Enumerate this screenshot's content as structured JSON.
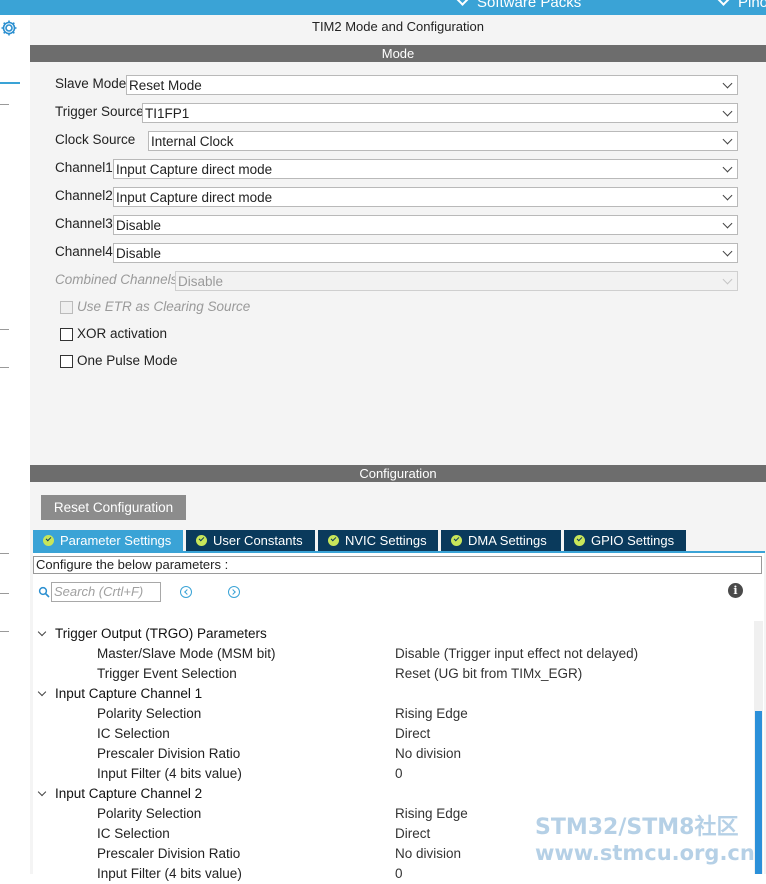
{
  "topbar": {
    "menus": [
      "Software Packs",
      "Pinout"
    ]
  },
  "sidebar": {
    "icon": "gear-icon"
  },
  "title": "TIM2 Mode and Configuration",
  "mode": {
    "header": "Mode",
    "fields": [
      {
        "label": "Slave Mode",
        "value": "Reset Mode",
        "disabled": false
      },
      {
        "label": "Trigger Source",
        "value": "TI1FP1",
        "disabled": false
      },
      {
        "label": "Clock Source",
        "value": "Internal Clock",
        "disabled": false
      },
      {
        "label": "Channel1",
        "value": "Input Capture direct mode",
        "disabled": false
      },
      {
        "label": "Channel2",
        "value": "Input Capture direct mode",
        "disabled": false
      },
      {
        "label": "Channel3",
        "value": "Disable",
        "disabled": false
      },
      {
        "label": "Channel4",
        "value": "Disable",
        "disabled": false
      },
      {
        "label": "Combined Channels",
        "value": "Disable",
        "disabled": true
      }
    ],
    "checkboxes": [
      {
        "label": "Use ETR as Clearing Source",
        "checked": false,
        "disabled": true
      },
      {
        "label": "XOR activation",
        "checked": false,
        "disabled": false
      },
      {
        "label": "One Pulse Mode",
        "checked": false,
        "disabled": false
      }
    ]
  },
  "configuration": {
    "header": "Configuration",
    "reset_label": "Reset Configuration",
    "tabs": [
      {
        "label": "Parameter Settings",
        "active": true
      },
      {
        "label": "User Constants",
        "active": false
      },
      {
        "label": "NVIC Settings",
        "active": false
      },
      {
        "label": "DMA Settings",
        "active": false
      },
      {
        "label": "GPIO Settings",
        "active": false
      }
    ],
    "configure_text": "Configure the below parameters :",
    "search_placeholder": "Search (Crtl+F)",
    "groups": [
      {
        "label": "Trigger Output (TRGO) Parameters",
        "params": [
          {
            "label": "Master/Slave Mode (MSM bit)",
            "value": "Disable (Trigger input effect not delayed)"
          },
          {
            "label": "Trigger Event Selection",
            "value": "Reset (UG bit from TIMx_EGR)"
          }
        ]
      },
      {
        "label": "Input Capture Channel 1",
        "params": [
          {
            "label": "Polarity Selection",
            "value": "Rising Edge"
          },
          {
            "label": "IC Selection",
            "value": "Direct"
          },
          {
            "label": "Prescaler Division Ratio",
            "value": "No division"
          },
          {
            "label": "Input Filter (4 bits value)",
            "value": "0"
          }
        ]
      },
      {
        "label": "Input Capture Channel 2",
        "params": [
          {
            "label": "Polarity Selection",
            "value": "Rising Edge"
          },
          {
            "label": "IC Selection",
            "value": "Direct"
          },
          {
            "label": "Prescaler Division Ratio",
            "value": "No division"
          },
          {
            "label": "Input Filter (4 bits value)",
            "value": "0"
          }
        ]
      }
    ]
  },
  "watermark": {
    "line1": "STM32/STM8社区",
    "line2": "www.stmcu.org.cn"
  }
}
